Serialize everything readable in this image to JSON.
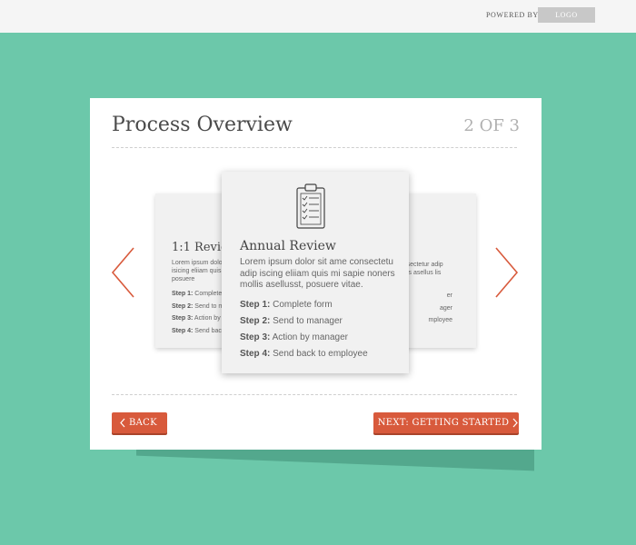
{
  "header": {
    "powered_by": "POWERED BY",
    "logo_label": "LOGO"
  },
  "card": {
    "title": "Process Overview",
    "counter": "2 OF 3"
  },
  "carousel": {
    "prev_slide": {
      "title": "1:1 Revie",
      "body": "Lorem ipsum dolo sit ame consectetu adip isicing eliiam quis mi sapie noners enim est, posuere",
      "steps": [
        {
          "label": "Step 1:",
          "text": "Complete"
        },
        {
          "label": "Step 2:",
          "text": "Send to m"
        },
        {
          "label": "Step 3:",
          "text": "Action by"
        },
        {
          "label": "Step 4:",
          "text": "Send back"
        }
      ]
    },
    "active_slide": {
      "icon": "clipboard-icon",
      "title": "Annual Review",
      "body": "Lorem ipsum dolor sit ame consectetu adip iscing eliiam quis mi sapie noners mollis asellusst, posuere vitae.",
      "steps": [
        {
          "label": "Step 1:",
          "text": "Complete form"
        },
        {
          "label": "Step 2:",
          "text": "Send to manager"
        },
        {
          "label": "Step 3:",
          "text": "Action by manager"
        },
        {
          "label": "Step 4:",
          "text": "Send back to employee"
        }
      ]
    },
    "next_slide": {
      "body": "Lorem ipsum dolor sit amet, consectetur adip iscing elit quis mi sapie non mollis asellus lis asellus",
      "steps": [
        {
          "text": "er"
        },
        {
          "text": "ager"
        },
        {
          "text": "mployee"
        }
      ]
    }
  },
  "footer": {
    "back_label": "BACK",
    "next_label": "NEXT: GETTING STARTED"
  },
  "colors": {
    "background": "#6cc8aa",
    "accent": "#d85a3c",
    "card": "#ffffff",
    "slide": "#f1f1f1"
  }
}
